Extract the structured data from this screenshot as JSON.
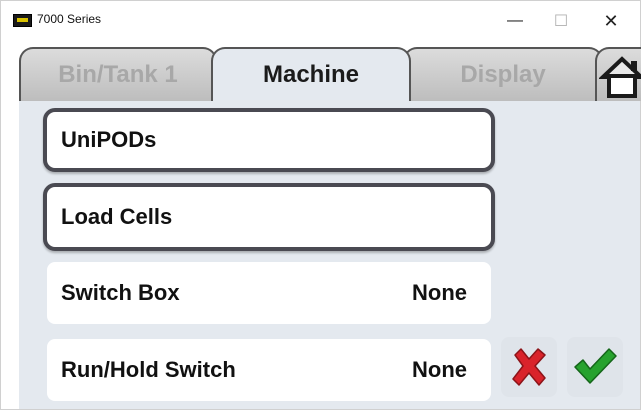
{
  "window": {
    "title": "7000 Series",
    "minimize_glyph": "—",
    "maximize_glyph": "☐",
    "close_glyph": "✕"
  },
  "tabs": [
    {
      "label": "Bin/Tank 1",
      "active": false
    },
    {
      "label": "Machine",
      "active": true
    },
    {
      "label": "Display",
      "active": false
    }
  ],
  "home_icon": "home-icon",
  "items": [
    {
      "label": "UniPODs",
      "value": ""
    },
    {
      "label": "Load Cells",
      "value": ""
    },
    {
      "label": "Switch Box",
      "value": "None"
    },
    {
      "label": "Run/Hold Switch",
      "value": "None"
    }
  ],
  "actions": {
    "cancel_icon": "cancel-x-icon",
    "ok_icon": "checkmark-icon"
  },
  "colors": {
    "content_bg": "#e4e9ef",
    "cancel": "#d9232b",
    "ok": "#27a22e"
  }
}
